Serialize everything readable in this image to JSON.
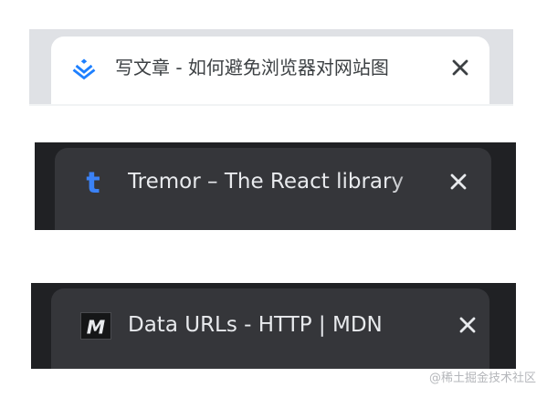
{
  "tabs": [
    {
      "theme": "light",
      "favicon": "juejin-icon",
      "title": "写文章 - 如何避免浏览器对网站图",
      "close_label": "×"
    },
    {
      "theme": "dark",
      "favicon": "tremor-icon",
      "favicon_letter": "t",
      "title": "Tremor – The React library",
      "close_label": "×"
    },
    {
      "theme": "dark",
      "favicon": "mdn-icon",
      "favicon_letter": "M",
      "title": "Data URLs - HTTP | MDN",
      "close_label": "×"
    }
  ],
  "watermark": "@稀土掘金技术社区",
  "colors": {
    "light_strip_bg": "#dfe1e5",
    "light_tab_bg": "#ffffff",
    "light_text": "#3c4043",
    "dark_strip_bg": "#202124",
    "dark_tab_bg": "#35363a",
    "dark_text": "#e8eaed",
    "juejin_blue": "#1e80ff",
    "tremor_blue": "#3b82f6"
  }
}
